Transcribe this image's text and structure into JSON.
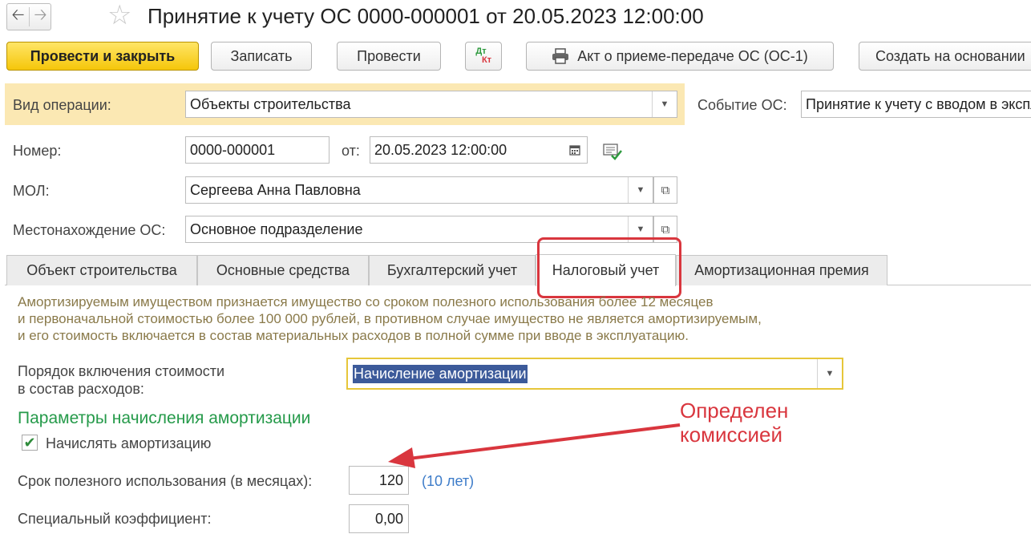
{
  "window": {
    "title": "Принятие к учету ОС 0000-000001 от 20.05.2023 12:00:00",
    "back_icon": "arrow-left-icon",
    "forward_icon": "arrow-right-icon",
    "favorite_icon": "star-icon"
  },
  "toolbar": {
    "post_and_close": "Провести и закрыть",
    "save": "Записать",
    "post": "Провести",
    "dtkt_top": "Дт",
    "dtkt_bottom": "Кт",
    "print_act": "Акт о приеме-передаче ОС (ОС-1)",
    "create_based": "Создать на основании"
  },
  "header": {
    "operation_label": "Вид операции:",
    "operation_value": "Объекты строительства",
    "event_label": "Событие ОС:",
    "event_value": "Принятие к учету с вводом в эксплуатацию",
    "number_label": "Номер:",
    "number_value": "0000-000001",
    "date_label": "от:",
    "date_value": "20.05.2023 12:00:00",
    "mol_label": "МОЛ:",
    "mol_value": "Сергеева Анна Павловна",
    "location_label": "Местонахождение ОС:",
    "location_value": "Основное подразделение"
  },
  "tabs": [
    {
      "label": "Объект строительства"
    },
    {
      "label": "Основные средства"
    },
    {
      "label": "Бухгалтерский учет"
    },
    {
      "label": "Налоговый учет"
    },
    {
      "label": "Амортизационная премия"
    }
  ],
  "tax": {
    "info_lines": [
      "Амортизируемым имуществом признается имущество со сроком полезного использования более 12 месяцев",
      "и первоначальной стоимостью более 100 000 рублей, в противном случае имущество не является амортизируемым,",
      "и его стоимость включается в состав материальных расходов в полной сумме при вводе в эксплуатацию."
    ],
    "order_label_line1": "Порядок включения стоимости",
    "order_label_line2": "в состав расходов:",
    "order_value": "Начисление амортизации",
    "section_title": "Параметры начисления амортизации",
    "accrue_label": "Начислять амортизацию",
    "accrue_checked": true,
    "useful_life_label": "Срок полезного использования (в месяцах):",
    "useful_life_value": "120",
    "useful_life_hint": "(10 лет)",
    "coef_label": "Специальный коэффициент:",
    "coef_value": "0,00"
  },
  "annotation": {
    "line1": "Определен",
    "line2": "комиссией",
    "color": "#d9363e"
  }
}
